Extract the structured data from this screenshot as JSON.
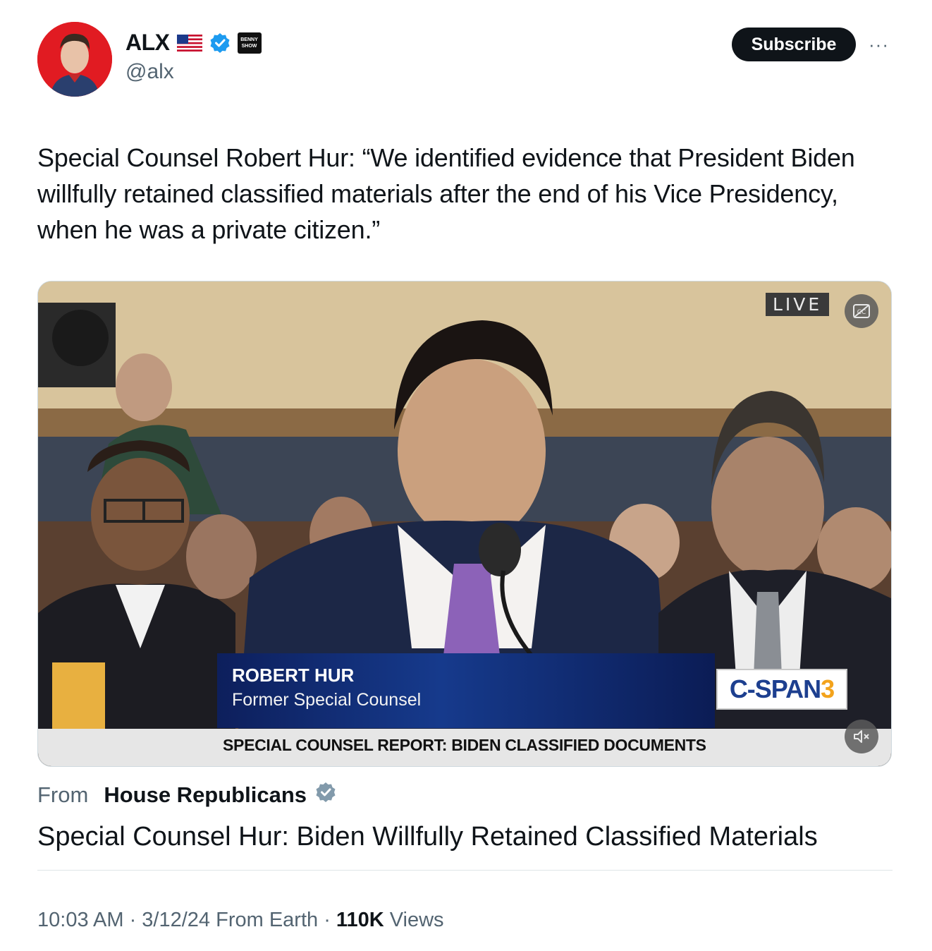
{
  "author": {
    "name": "ALX",
    "handle": "@alx",
    "flag_icon": "us-flag-icon",
    "verified_icon": "verified-badge-icon",
    "affiliation_badge": "BENNY SHOW",
    "avatar_color": "#e11b22"
  },
  "header": {
    "subscribe_label": "Subscribe",
    "more_label": "···"
  },
  "tweet": {
    "text": "Special Counsel Robert Hur: “We identified evidence that President Biden willfully retained classified materials after the end of his Vice Presidency, when he was a private citizen.”"
  },
  "video": {
    "live_label": "LIVE",
    "lower_third_name": "ROBERT HUR",
    "lower_third_title": "Former Special Counsel",
    "network_prefix": "C-SPAN",
    "network_suffix": "3",
    "ticker": "SPECIAL COUNSEL REPORT: BIDEN CLASSIFIED DOCUMENTS",
    "captions_icon": "closed-captions-icon",
    "mute_icon": "muted-speaker-icon"
  },
  "source": {
    "from_label": "From",
    "name": "House Republicans",
    "verified_icon": "verified-gray-badge-icon"
  },
  "video_title": "Special Counsel Hur: Biden Willfully Retained Classified Materials",
  "meta": {
    "time_date": "10:03 AM · 3/12/24 From Earth · ",
    "views_count": "110K",
    "views_label": " Views"
  }
}
